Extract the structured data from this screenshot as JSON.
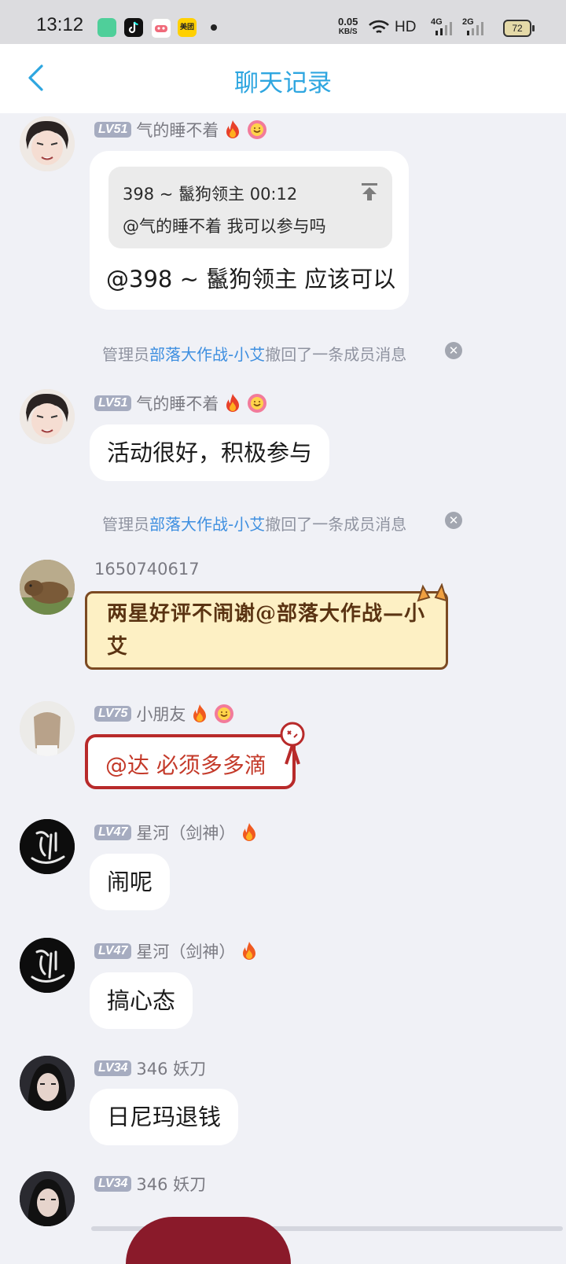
{
  "status_bar": {
    "time": "13:12",
    "net_speed": "0.05",
    "net_unit": "KB/S",
    "hd_label": "HD",
    "signal1_label": "4G",
    "signal2_label": "2G",
    "battery": "72",
    "app_icons": [
      "green-app-icon",
      "tiktok-icon",
      "game-app-icon",
      "meituan-icon"
    ],
    "meituan_label": "美团"
  },
  "header": {
    "title": "聊天记录",
    "back_icon": "chevron-left-icon"
  },
  "messages": [
    {
      "level": "LV51",
      "name": "气的睡不着",
      "quote_line1": "398 ~ 鬣狗领主 00:12",
      "quote_line2": "@气的睡不着 我可以参与吗",
      "text": "@398 ~ 鬣狗领主 应该可以"
    },
    {
      "level": "LV51",
      "name": "气的睡不着",
      "text": "活动很好，积极参与"
    },
    {
      "name": "1650740617",
      "text": "两星好评不闹谢@部落大作战—小艾"
    },
    {
      "level": "LV75",
      "name": "小朋友",
      "text": "@达 必须多多滴"
    },
    {
      "level": "LV47",
      "name": "星河（剑神）",
      "text": "闹呢"
    },
    {
      "level": "LV47",
      "name": "星河（剑神）",
      "text": "搞心态"
    },
    {
      "level": "LV34",
      "name": "346  妖刀",
      "text": "日尼玛退钱"
    },
    {
      "level": "LV34",
      "name": "346  妖刀"
    }
  ],
  "recall": {
    "prefix": "管理员",
    "admin": "部落大作战-小艾",
    "suffix": "撤回了一条成员消息"
  },
  "colors": {
    "accent": "#2ea6e0",
    "background": "#f0f1f6",
    "admin_link": "#3e8fe0"
  }
}
